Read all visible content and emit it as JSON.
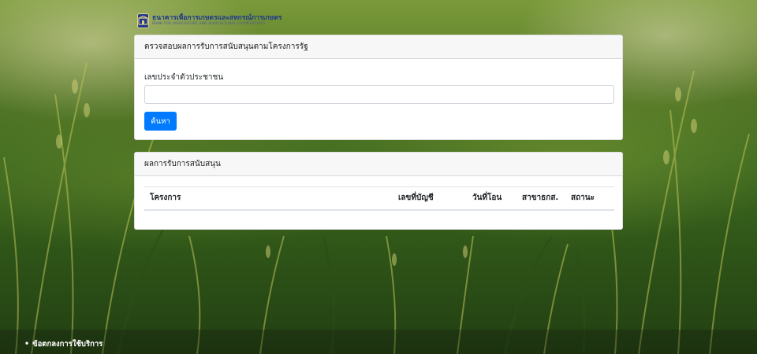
{
  "logo": {
    "name_th": "ธนาคารเพื่อการเกษตรและสหกรณ์การเกษตร",
    "name_en": "BANK FOR AGRICULTURE AND AGRICULTURAL COOPERATIVES"
  },
  "search_card": {
    "header": "ตรวจสอบผลการรับการสนับสนุนตามโครงการรัฐ",
    "field_label": "เลขประจำตัวประชาชน",
    "input_value": "",
    "button_label": "ค้นหา"
  },
  "results_card": {
    "header": "ผลการรับการสนับสนุน",
    "columns": [
      "โครงการ",
      "เลขที่บัญชี",
      "วันที่โอน",
      "สาขาธกส.",
      "สถานะ"
    ],
    "rows": []
  },
  "footer": {
    "bullet": "•",
    "link": "ข้อตกลงการใช้บริการ"
  },
  "colors": {
    "primary_button": "#007bff",
    "card_header_bg": "#f7f7f7",
    "logo_blue": "#1f3a8a"
  }
}
